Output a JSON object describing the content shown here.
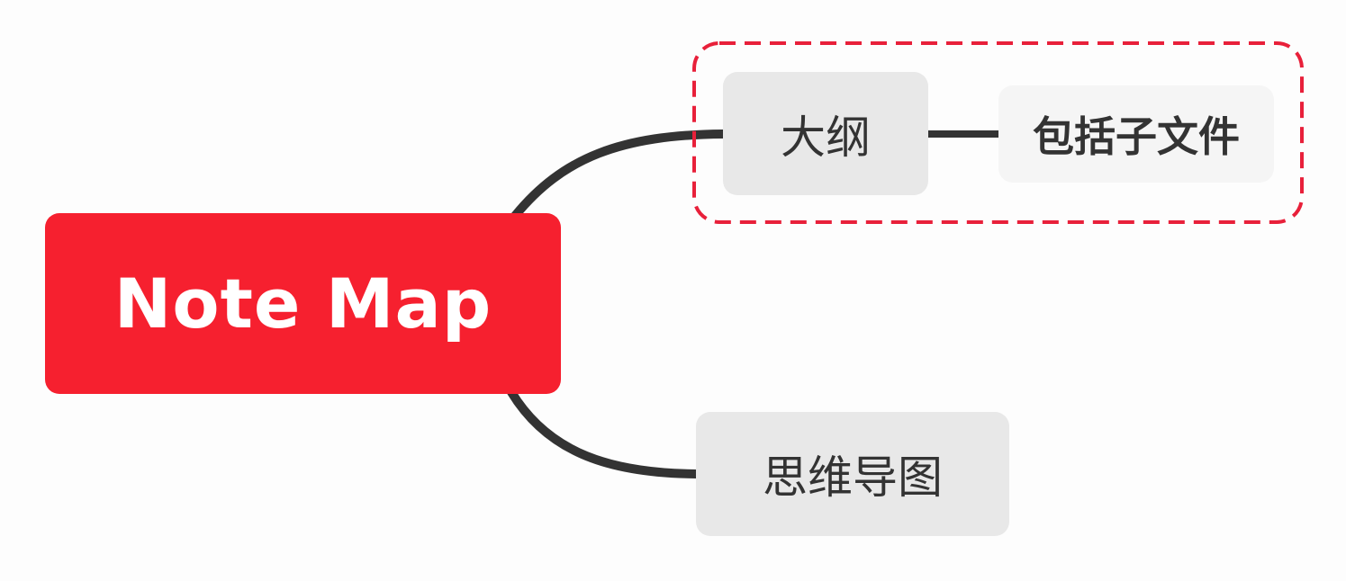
{
  "root": {
    "label": "Note Map"
  },
  "branches": [
    {
      "label": "大纲",
      "children": [
        {
          "label": "包括子文件"
        }
      ],
      "highlighted": true
    },
    {
      "label": "思维导图",
      "children": []
    }
  ],
  "colors": {
    "root_fill": "#f6202f",
    "root_text": "#ffffff",
    "topic_fill": "#e8e8e8",
    "subtopic_fill": "#f5f5f5",
    "topic_text": "#333333",
    "connector": "#333333",
    "highlight_boundary": "#e8203a",
    "background": "#fdfdfd"
  }
}
